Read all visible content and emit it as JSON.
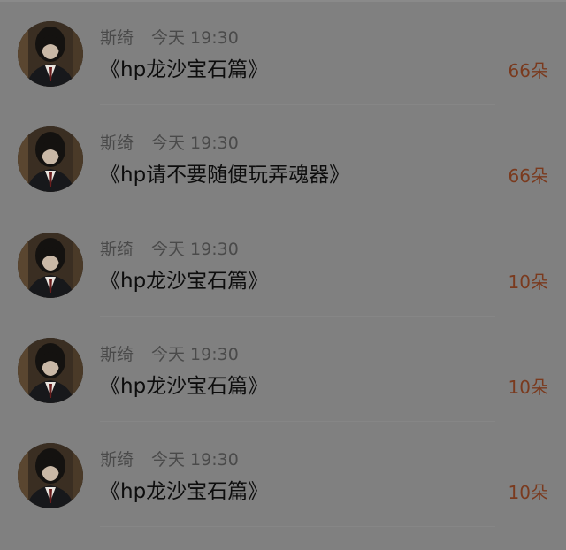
{
  "messages": [
    {
      "name": "斯绮",
      "time": "今天 19:30",
      "title": "《hp龙沙宝石篇》",
      "gift": "66朵"
    },
    {
      "name": "斯绮",
      "time": "今天 19:30",
      "title": "《hp请不要随便玩弄魂器》",
      "gift": "66朵"
    },
    {
      "name": "斯绮",
      "time": "今天 19:30",
      "title": "《hp龙沙宝石篇》",
      "gift": "10朵"
    },
    {
      "name": "斯绮",
      "time": "今天 19:30",
      "title": "《hp龙沙宝石篇》",
      "gift": "10朵"
    },
    {
      "name": "斯绮",
      "time": "今天 19:30",
      "title": "《hp龙沙宝石篇》",
      "gift": "10朵"
    }
  ],
  "colors": {
    "background": "#808080",
    "gift_accent": "#7a3a1e",
    "title_text": "#0d0d0d",
    "meta_text": "#4a4a4a"
  },
  "icons": {
    "avatar": "avatar-portrait-icon"
  }
}
